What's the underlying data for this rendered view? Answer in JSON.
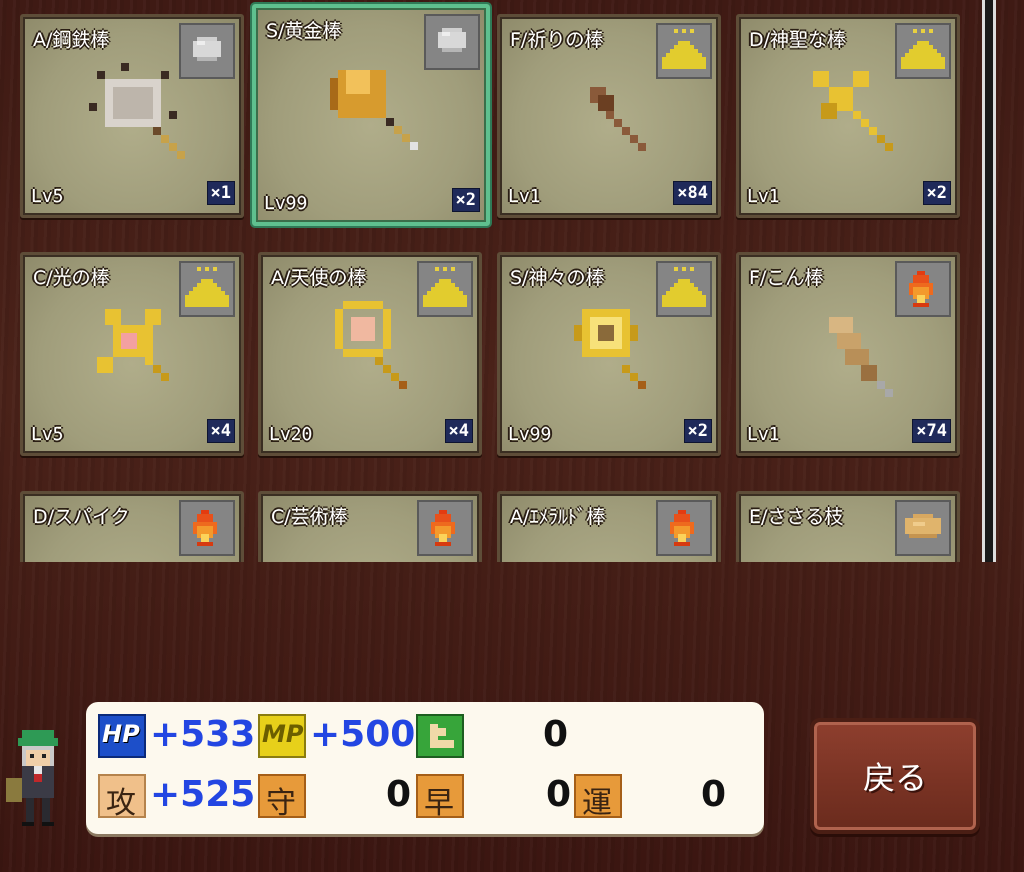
{
  "items": [
    {
      "name": "A/鋼鉄棒",
      "level": "Lv5",
      "qty": "×1",
      "element": "stone-icon",
      "weapon": "mace-steel",
      "selected": false
    },
    {
      "name": "S/黄金棒",
      "level": "Lv99",
      "qty": "×2",
      "element": "stone-icon",
      "weapon": "mace-gold",
      "selected": true
    },
    {
      "name": "F/祈りの棒",
      "level": "Lv1",
      "qty": "×84",
      "element": "sand-icon",
      "weapon": "prayer-rod",
      "selected": false
    },
    {
      "name": "D/神聖な棒",
      "level": "Lv1",
      "qty": "×2",
      "element": "sand-icon",
      "weapon": "holy-rod",
      "selected": false
    },
    {
      "name": "C/光の棒",
      "level": "Lv5",
      "qty": "×4",
      "element": "sand-icon",
      "weapon": "light-rod",
      "selected": false
    },
    {
      "name": "A/天使の棒",
      "level": "Lv20",
      "qty": "×4",
      "element": "sand-icon",
      "weapon": "angel-rod",
      "selected": false
    },
    {
      "name": "S/神々の棒",
      "level": "Lv99",
      "qty": "×2",
      "element": "sand-icon",
      "weapon": "gods-rod",
      "selected": false
    },
    {
      "name": "F/こん棒",
      "level": "Lv1",
      "qty": "×74",
      "element": "fire-icon",
      "weapon": "club",
      "selected": false
    },
    {
      "name": "D/スパイク",
      "level": "",
      "qty": "",
      "element": "fire-icon",
      "weapon": "spike",
      "selected": false
    },
    {
      "name": "C/芸術棒",
      "level": "",
      "qty": "",
      "element": "fire-icon",
      "weapon": "art-rod",
      "selected": false
    },
    {
      "name": "A/ｴﾒﾗﾙﾄﾞ棒",
      "level": "",
      "qty": "",
      "element": "fire-icon",
      "weapon": "emerald-rod",
      "selected": false
    },
    {
      "name": "E/ささる枝",
      "level": "",
      "qty": "",
      "element": "bread-icon",
      "weapon": "branch",
      "selected": false
    }
  ],
  "stats": {
    "hp": {
      "icon": "hp-icon",
      "label": "HP",
      "value": "+533"
    },
    "mp": {
      "icon": "mp-icon",
      "label": "MP",
      "value": "+500"
    },
    "power": {
      "icon": "strength-icon",
      "value": "0"
    },
    "attack": {
      "icon": "attack-icon",
      "value": "+525"
    },
    "defense": {
      "icon": "defense-icon",
      "value": "0"
    },
    "magic": {
      "icon": "magic-icon",
      "value": "0"
    },
    "luck": {
      "icon": "luck-icon",
      "value": "0"
    }
  },
  "back_button": {
    "label": "戻る"
  },
  "colors": {
    "accent_selected": "#5fc08f",
    "stat_positive": "#2346e2",
    "button": "#7a3324"
  }
}
